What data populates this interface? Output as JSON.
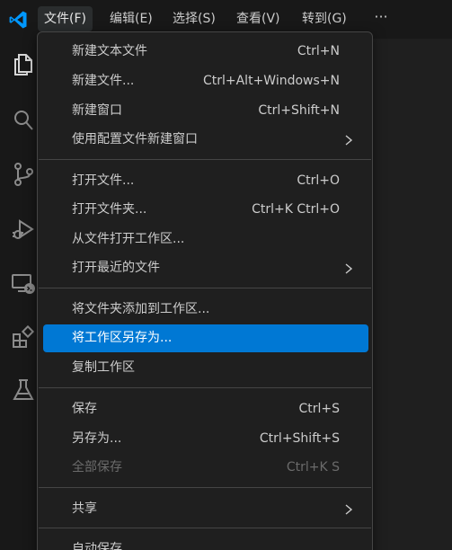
{
  "menubar": {
    "items": [
      {
        "label": "文件(F)",
        "active": true
      },
      {
        "label": "编辑(E)"
      },
      {
        "label": "选择(S)"
      },
      {
        "label": "查看(V)"
      },
      {
        "label": "转到(G)"
      }
    ],
    "more_label": "···"
  },
  "activity_bar": {
    "icons": [
      "explorer-icon",
      "search-icon",
      "source-control-icon",
      "run-debug-icon",
      "remote-explorer-icon",
      "extensions-icon",
      "testing-icon"
    ]
  },
  "file_menu": {
    "groups": [
      [
        {
          "label": "新建文本文件",
          "shortcut": "Ctrl+N"
        },
        {
          "label": "新建文件...",
          "shortcut": "Ctrl+Alt+Windows+N"
        },
        {
          "label": "新建窗口",
          "shortcut": "Ctrl+Shift+N"
        },
        {
          "label": "使用配置文件新建窗口",
          "submenu": true
        }
      ],
      [
        {
          "label": "打开文件...",
          "shortcut": "Ctrl+O"
        },
        {
          "label": "打开文件夹...",
          "shortcut": "Ctrl+K Ctrl+O"
        },
        {
          "label": "从文件打开工作区..."
        },
        {
          "label": "打开最近的文件",
          "submenu": true
        }
      ],
      [
        {
          "label": "将文件夹添加到工作区..."
        },
        {
          "label": "将工作区另存为...",
          "selected": true
        },
        {
          "label": "复制工作区"
        }
      ],
      [
        {
          "label": "保存",
          "shortcut": "Ctrl+S"
        },
        {
          "label": "另存为...",
          "shortcut": "Ctrl+Shift+S"
        },
        {
          "label": "全部保存",
          "shortcut": "Ctrl+K S",
          "disabled": true
        }
      ],
      [
        {
          "label": "共享",
          "submenu": true
        }
      ],
      [
        {
          "label": "自动保存"
        }
      ]
    ]
  },
  "colors": {
    "accent": "#0078d4",
    "menu_bg": "#1f1f1f",
    "bar_bg": "#181818",
    "text": "#cccccc",
    "disabled_text": "#6b6b6b",
    "logo": "#0098ff"
  }
}
